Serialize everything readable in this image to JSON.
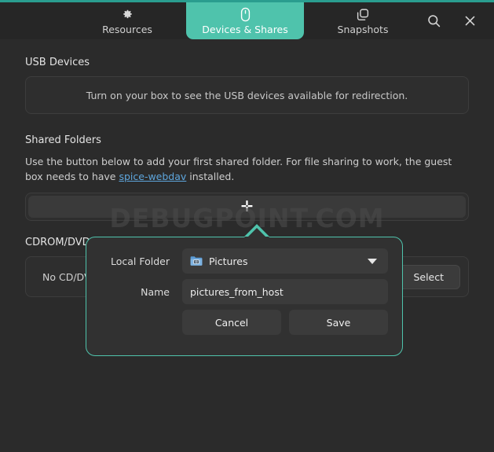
{
  "window": {
    "accent_color": "#4fc3ac",
    "background": "#2b2b2b"
  },
  "header": {
    "tabs": [
      {
        "label": "Resources",
        "icon": "gear-icon",
        "active": false
      },
      {
        "label": "Devices & Shares",
        "icon": "mouse-icon",
        "active": true
      },
      {
        "label": "Snapshots",
        "icon": "copies-icon",
        "active": false
      }
    ],
    "actions": [
      {
        "name": "search-button",
        "icon": "search-icon"
      },
      {
        "name": "close-button",
        "icon": "close-icon"
      }
    ]
  },
  "usb": {
    "title": "USB Devices",
    "empty_message": "Turn on your box to see the USB devices available for redirection."
  },
  "shared_folders": {
    "title": "Shared Folders",
    "description_before": "Use the button below to add your first shared folder. For file sharing to work, the guest box needs to have ",
    "link_text": "spice-webdav",
    "description_after": " installed.",
    "add_button_icon": "plus-icon"
  },
  "cdrom": {
    "title": "CDROM/DVD Drive",
    "status": "No CD/DVD image selected",
    "select_label": "Select"
  },
  "popover": {
    "local_folder_label": "Local Folder",
    "local_folder_value": "Pictures",
    "local_folder_icon": "pictures-folder-icon",
    "name_label": "Name",
    "name_value": "pictures_from_host",
    "name_placeholder": "Name",
    "cancel_label": "Cancel",
    "save_label": "Save"
  },
  "watermark": {
    "text": "DEBUGPOINT.COM"
  }
}
